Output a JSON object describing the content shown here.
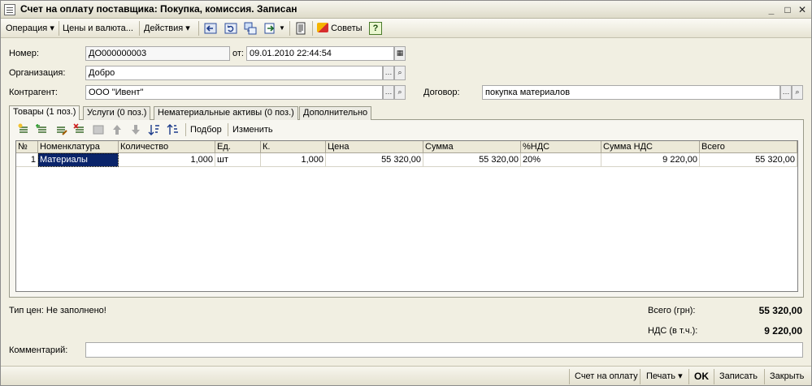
{
  "window": {
    "title": "Счет на оплату поставщика: Покупка, комиссия. Записан"
  },
  "toolbar": {
    "operation": "Операция",
    "prices": "Цены и валюта...",
    "actions": "Действия",
    "tips": "Советы",
    "help": "?"
  },
  "form": {
    "number_label": "Номер:",
    "number_value": "ДО000000003",
    "date_label": "от:",
    "date_value": "09.01.2010 22:44:54",
    "org_label": "Организация:",
    "org_value": "Добро",
    "contractor_label": "Контрагент:",
    "contractor_value": "ООО \"Ивент\"",
    "contract_label": "Договор:",
    "contract_value": "покупка материалов"
  },
  "tabs": [
    {
      "label": "Товары (1 поз.)"
    },
    {
      "label": "Услуги (0 поз.)"
    },
    {
      "label": "Нематериальные активы (0 поз.)"
    },
    {
      "label": "Дополнительно"
    }
  ],
  "grid_toolbar": {
    "pick": "Подбор",
    "change": "Изменить"
  },
  "table": {
    "headers": [
      "№",
      "Номенклатура",
      "Количество",
      "Ед.",
      "К.",
      "Цена",
      "Сумма",
      "%НДС",
      "Сумма НДС",
      "Всего"
    ],
    "rows": [
      [
        "1",
        "Материалы",
        "1,000",
        "шт",
        "1,000",
        "55 320,00",
        "55 320,00",
        "20%",
        "9 220,00",
        "55 320,00"
      ]
    ]
  },
  "summary": {
    "price_type": "Тип цен: Не заполнено!",
    "total_label": "Всего (грн):",
    "total_value": "55 320,00",
    "vat_label": "НДС (в т.ч.):",
    "vat_value": "9 220,00"
  },
  "comment": {
    "label": "Комментарий:",
    "value": ""
  },
  "footer": {
    "invoice": "Счет на оплату",
    "print": "Печать",
    "ok": "OK",
    "save": "Записать",
    "close": "Закрыть"
  },
  "colors": {
    "selection": "#0a246a",
    "window_bg": "#f1efe2"
  }
}
